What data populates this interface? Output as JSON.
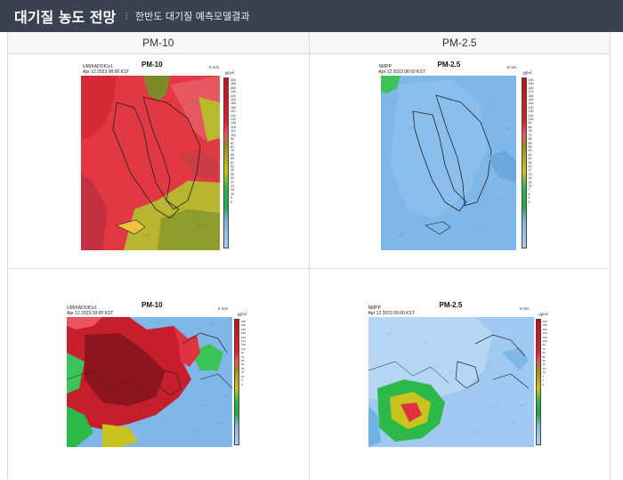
{
  "header": {
    "title": "대기질 농도 전망",
    "subtitle": "한반도 대기질 예측모델결과"
  },
  "columns": [
    "PM-10",
    "PM-2.5"
  ],
  "maps": [
    {
      "title": "PM-10",
      "model": "UM(KADOK)v1",
      "date": "Apr 12 2023 08:00 KST",
      "unit": "㎍/㎥",
      "wind": "5 m/s",
      "scale": [
        "300",
        "280",
        "260",
        "240",
        "220",
        "200",
        "180",
        "160",
        "151",
        "142",
        "134",
        "126",
        "118",
        "110",
        "102",
        "94",
        "87",
        "81",
        "75",
        "69",
        "63",
        "57",
        "51",
        "45",
        "39",
        "33",
        "27",
        "21",
        "15",
        "10",
        "5",
        "0"
      ]
    },
    {
      "title": "PM-2.5",
      "model": "NMPP",
      "date": "Apr 12 2023 08:00 KST",
      "unit": "㎍/㎥",
      "wind": "5 m/s",
      "scale": [
        "200",
        "190",
        "180",
        "170",
        "160",
        "150",
        "140",
        "130",
        "120",
        "110",
        "100",
        "90",
        "84",
        "78",
        "72",
        "66",
        "60",
        "55",
        "50",
        "45",
        "40",
        "35",
        "31",
        "27",
        "23",
        "19",
        "15",
        "11",
        "7",
        "4",
        "1",
        "0"
      ]
    },
    {
      "title": "PM-10",
      "model": "UM(KADOK)v1",
      "date": "Apr 12 2023 09:00 KST",
      "unit": "㎍/㎥",
      "wind": "5 m/s",
      "scale": [
        "300",
        "280",
        "260",
        "240",
        "220",
        "200",
        "180",
        "160",
        "151",
        "142",
        "134",
        "126",
        "118",
        "110",
        "102",
        "94",
        "87",
        "81",
        "75",
        "69",
        "63",
        "57",
        "51",
        "45",
        "39",
        "33",
        "27",
        "21",
        "15",
        "10",
        "5",
        "0"
      ]
    },
    {
      "title": "PM-2.5",
      "model": "NMPP",
      "date": "Apr 12 2023 09:00 KST",
      "unit": "㎍/㎥",
      "wind": "5 m/s",
      "scale": [
        "200",
        "190",
        "180",
        "170",
        "160",
        "150",
        "140",
        "130",
        "120",
        "110",
        "100",
        "90",
        "84",
        "78",
        "72",
        "66",
        "60",
        "55",
        "50",
        "45",
        "40",
        "35",
        "31",
        "27",
        "23",
        "19",
        "15",
        "11",
        "7",
        "4",
        "1",
        "0"
      ]
    }
  ],
  "colors": {
    "header_bg": "#3a4150",
    "low": "#7fb7e8",
    "good": "#2db84a",
    "moderate": "#c9c320",
    "high": "#e0333f",
    "very_high": "#8e1520"
  }
}
